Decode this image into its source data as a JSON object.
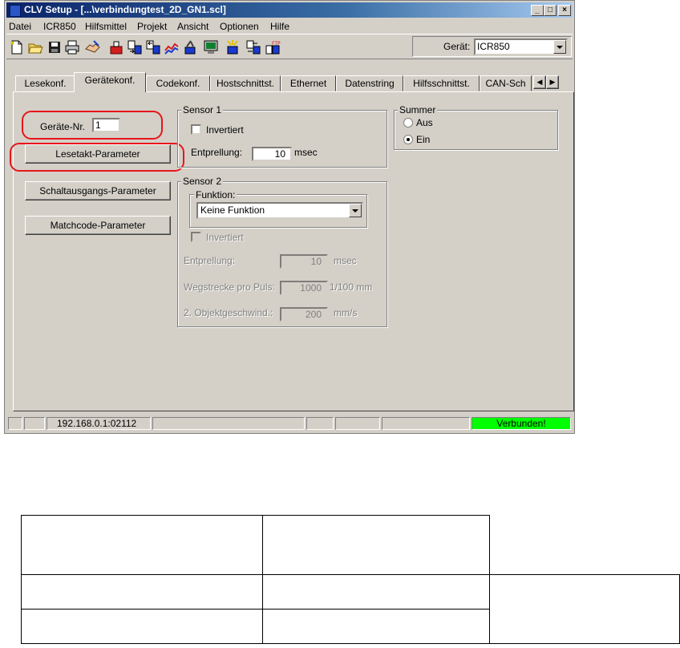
{
  "window": {
    "title": "CLV Setup - [...\\verbindungtest_2D_GN1.scl]",
    "controls": [
      "_",
      "□",
      "×"
    ]
  },
  "menu": [
    "Datei",
    "ICR850",
    "Hilfsmittel",
    "Projekt",
    "Ansicht",
    "Optionen",
    "Hilfe"
  ],
  "toolbar": {
    "icons": [
      "new-file-icon",
      "open-folder-icon",
      "save-icon",
      "print-icon",
      "handshake-icon",
      "device-icon",
      "upload-icon",
      "download-icon",
      "graph-icon",
      "tools-icon",
      "monitor-icon",
      "wizard-icon",
      "transfer-icon",
      "ftp-icon"
    ],
    "device_label": "Gerät:",
    "device_value": "ICR850"
  },
  "tabs": [
    "Lesekonf.",
    "Gerätekonf.",
    "Codekonf.",
    "Hostschnittst.",
    "Ethernet",
    "Datenstring",
    "Hilfsschnittst.",
    "CAN-Sch"
  ],
  "active_tab": "Gerätekonf.",
  "panel": {
    "geraete_nr_label": "Geräte-Nr.",
    "geraete_nr_value": "1",
    "btn_lesetakt": "Lesetakt-Parameter",
    "btn_schaltausgang": "Schaltausgangs-Parameter",
    "btn_matchcode": "Matchcode-Parameter",
    "sensor1": {
      "title": "Sensor 1",
      "invertiert": "Invertiert",
      "entprellung_label": "Entprellung:",
      "entprellung_value": "10",
      "entprellung_unit": "msec"
    },
    "sensor2": {
      "title": "Sensor 2",
      "funktion_title": "Funktion:",
      "funktion_value": "Keine Funktion",
      "invertiert": "Invertiert",
      "entprellung_label": "Entprellung:",
      "entprellung_value": "10",
      "entprellung_unit": "msec",
      "wegstrecke_label": "Wegstrecke pro Puls:",
      "wegstrecke_value": "1000",
      "wegstrecke_unit": "1/100 mm",
      "objekt_label": "2. Objektgeschwind.:",
      "objekt_value": "200",
      "objekt_unit": "mm/s"
    },
    "summer": {
      "title": "Summer",
      "aus": "Aus",
      "ein": "Ein",
      "selected": "Ein"
    }
  },
  "statusbar": {
    "address": "192.168.0.1:02112",
    "status": "Verbunden!",
    "status_color": "#00ff00"
  },
  "colors": {
    "title_bar": "#0a246a",
    "highlight_ring": "#e8151a",
    "face": "#d4d0c8"
  }
}
